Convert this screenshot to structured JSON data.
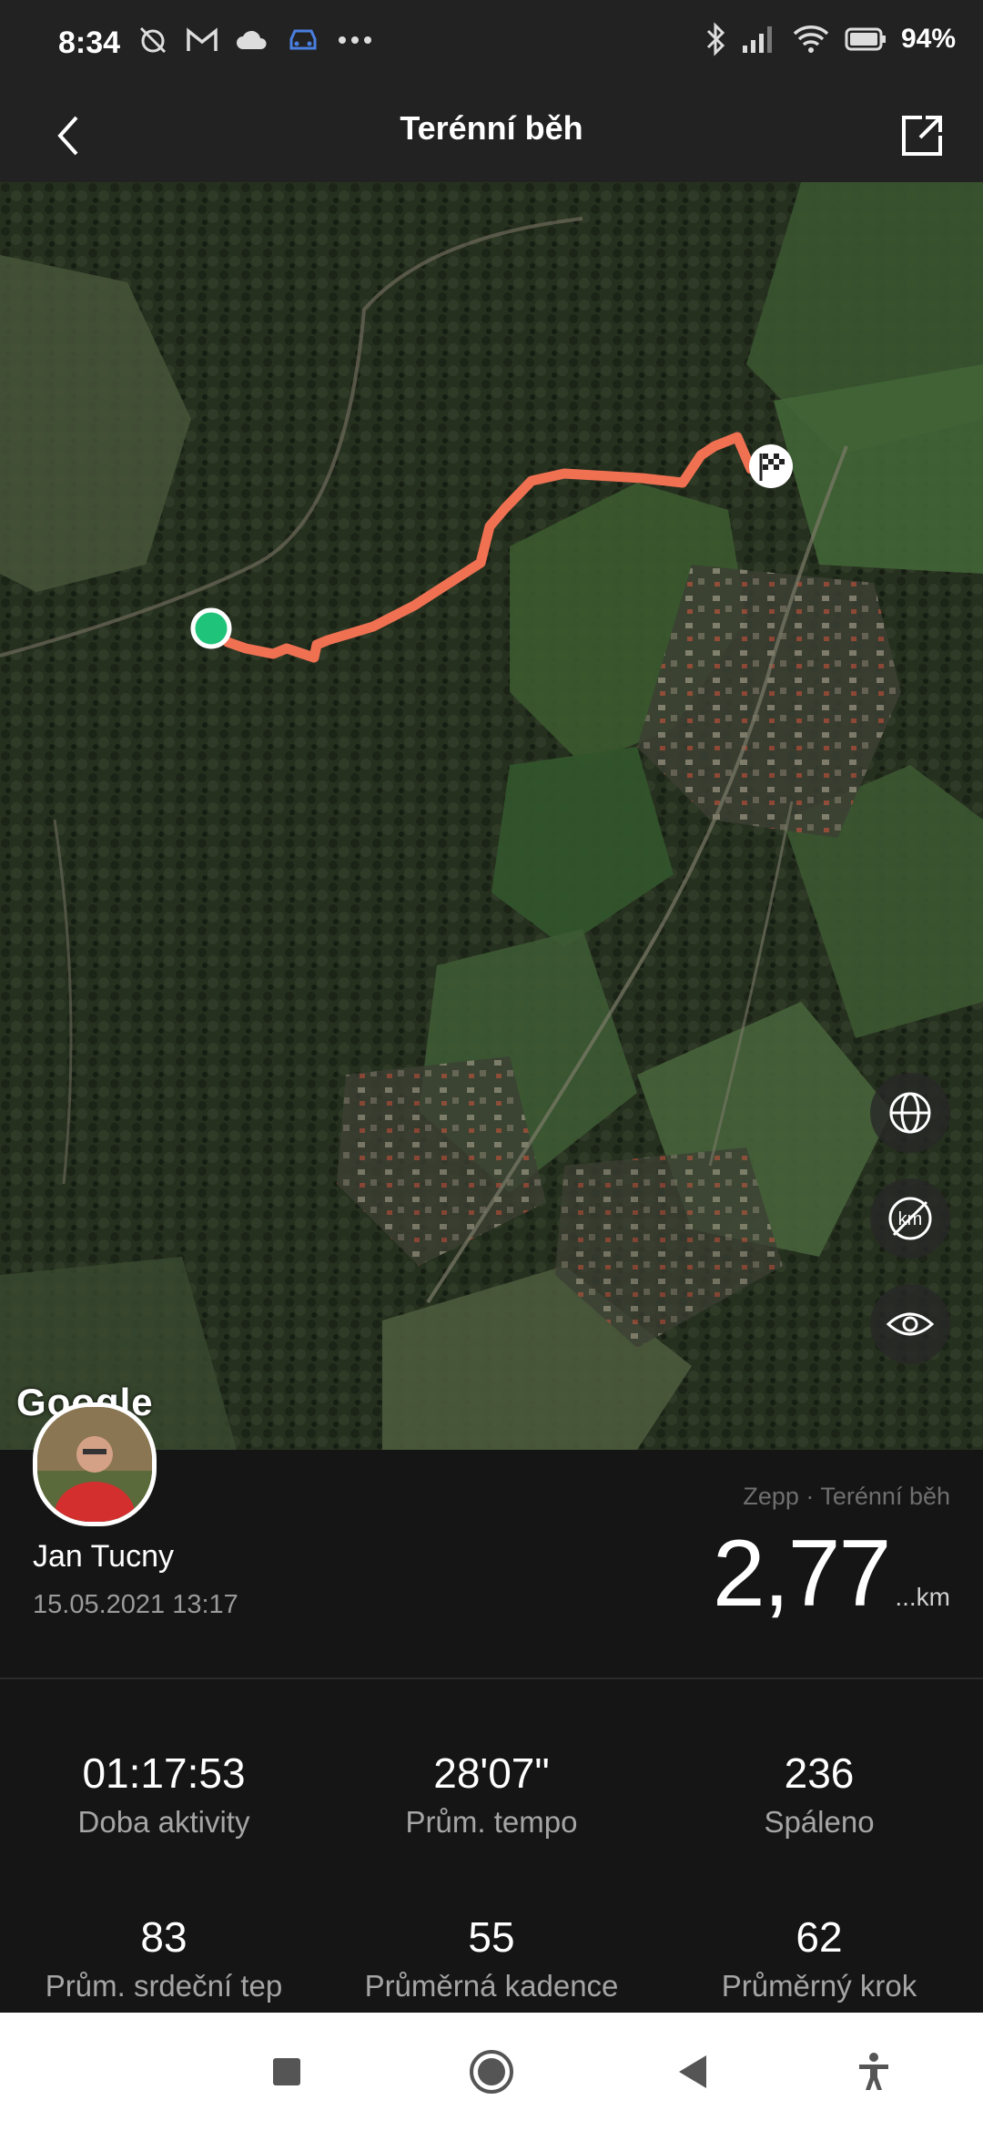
{
  "status_bar": {
    "time": "8:34",
    "battery": "94%",
    "icons_left": [
      "alarm-off-icon",
      "gmail-icon",
      "cloud-icon",
      "car-icon",
      "more-dots-icon"
    ],
    "icons_right": [
      "bluetooth-icon",
      "signal-icon",
      "wifi-icon",
      "battery-icon"
    ]
  },
  "header": {
    "title": "Terénní běh"
  },
  "map": {
    "google_logo": "Google",
    "controls": [
      "globe-icon",
      "km-off-icon",
      "eye-icon"
    ],
    "route_color": "#F07052",
    "start_color": "#1FC47A"
  },
  "activity": {
    "user_name": "Jan Tucny",
    "date": "15.05.2021 13:17",
    "source": "Zepp · Terénní běh",
    "distance": "2,77",
    "distance_unit": "...km"
  },
  "stats": [
    {
      "value": "01:17:53",
      "label": "Doba aktivity"
    },
    {
      "value": "28'07\"",
      "label": "Prům. tempo"
    },
    {
      "value": "236",
      "label": "Spáleno"
    },
    {
      "value": "83",
      "label": "Prům. srdeční tep"
    },
    {
      "value": "55",
      "label": "Průměrná kadence"
    },
    {
      "value": "62",
      "label": "Průměrný krok"
    }
  ],
  "nav_bar": [
    "recents-icon",
    "home-icon",
    "back-nav-icon",
    "accessibility-icon"
  ]
}
